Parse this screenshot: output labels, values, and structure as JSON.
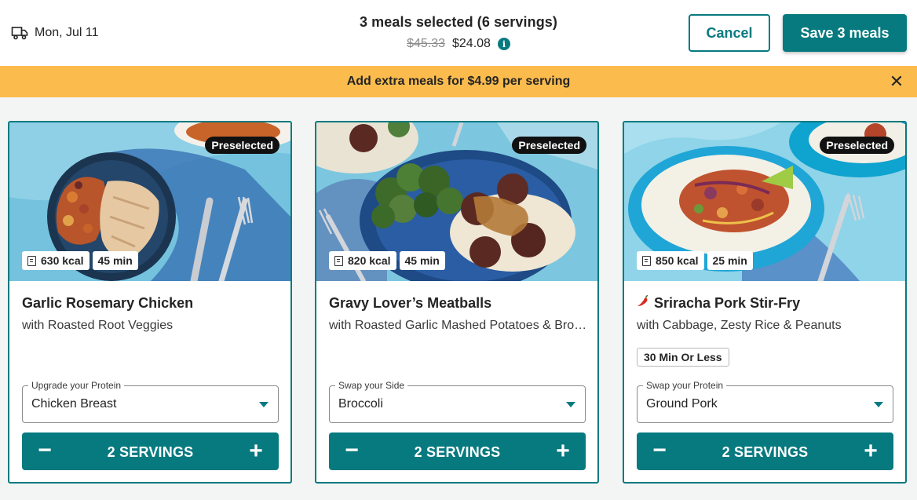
{
  "header": {
    "delivery_date": "Mon, Jul 11",
    "summary_title": "3 meals selected (6 servings)",
    "old_price": "$45.33",
    "new_price": "$24.08",
    "cancel_label": "Cancel",
    "save_label": "Save 3 meals"
  },
  "banner": {
    "text": "Add extra meals for $4.99 per serving"
  },
  "colors": {
    "accent": "#067a7f",
    "banner": "#fcbc4d",
    "badge": "#111111"
  },
  "meals": [
    {
      "badge": "Preselected",
      "kcal": "630 kcal",
      "time": "45 min",
      "title": "Garlic Rosemary Chicken",
      "subtitle": "with Roasted Root Veggies",
      "select_label": "Upgrade your Protein",
      "select_value": "Chicken Breast",
      "servings": "2 SERVINGS"
    },
    {
      "badge": "Preselected",
      "kcal": "820 kcal",
      "time": "45 min",
      "title": "Gravy Lover’s Meatballs",
      "subtitle": "with Roasted Garlic Mashed Potatoes & Broccoli",
      "select_label": "Swap your Side",
      "select_value": "Broccoli",
      "servings": "2 SERVINGS"
    },
    {
      "badge": "Preselected",
      "kcal": "850 kcal",
      "time": "25 min",
      "title": "Sriracha Pork Stir-Fry",
      "subtitle": "with Cabbage, Zesty Rice & Peanuts",
      "tag": "30 Min Or Less",
      "select_label": "Swap your Protein",
      "select_value": "Ground Pork",
      "servings": "2 SERVINGS",
      "spicy_icon": "chili-pepper-icon"
    }
  ]
}
